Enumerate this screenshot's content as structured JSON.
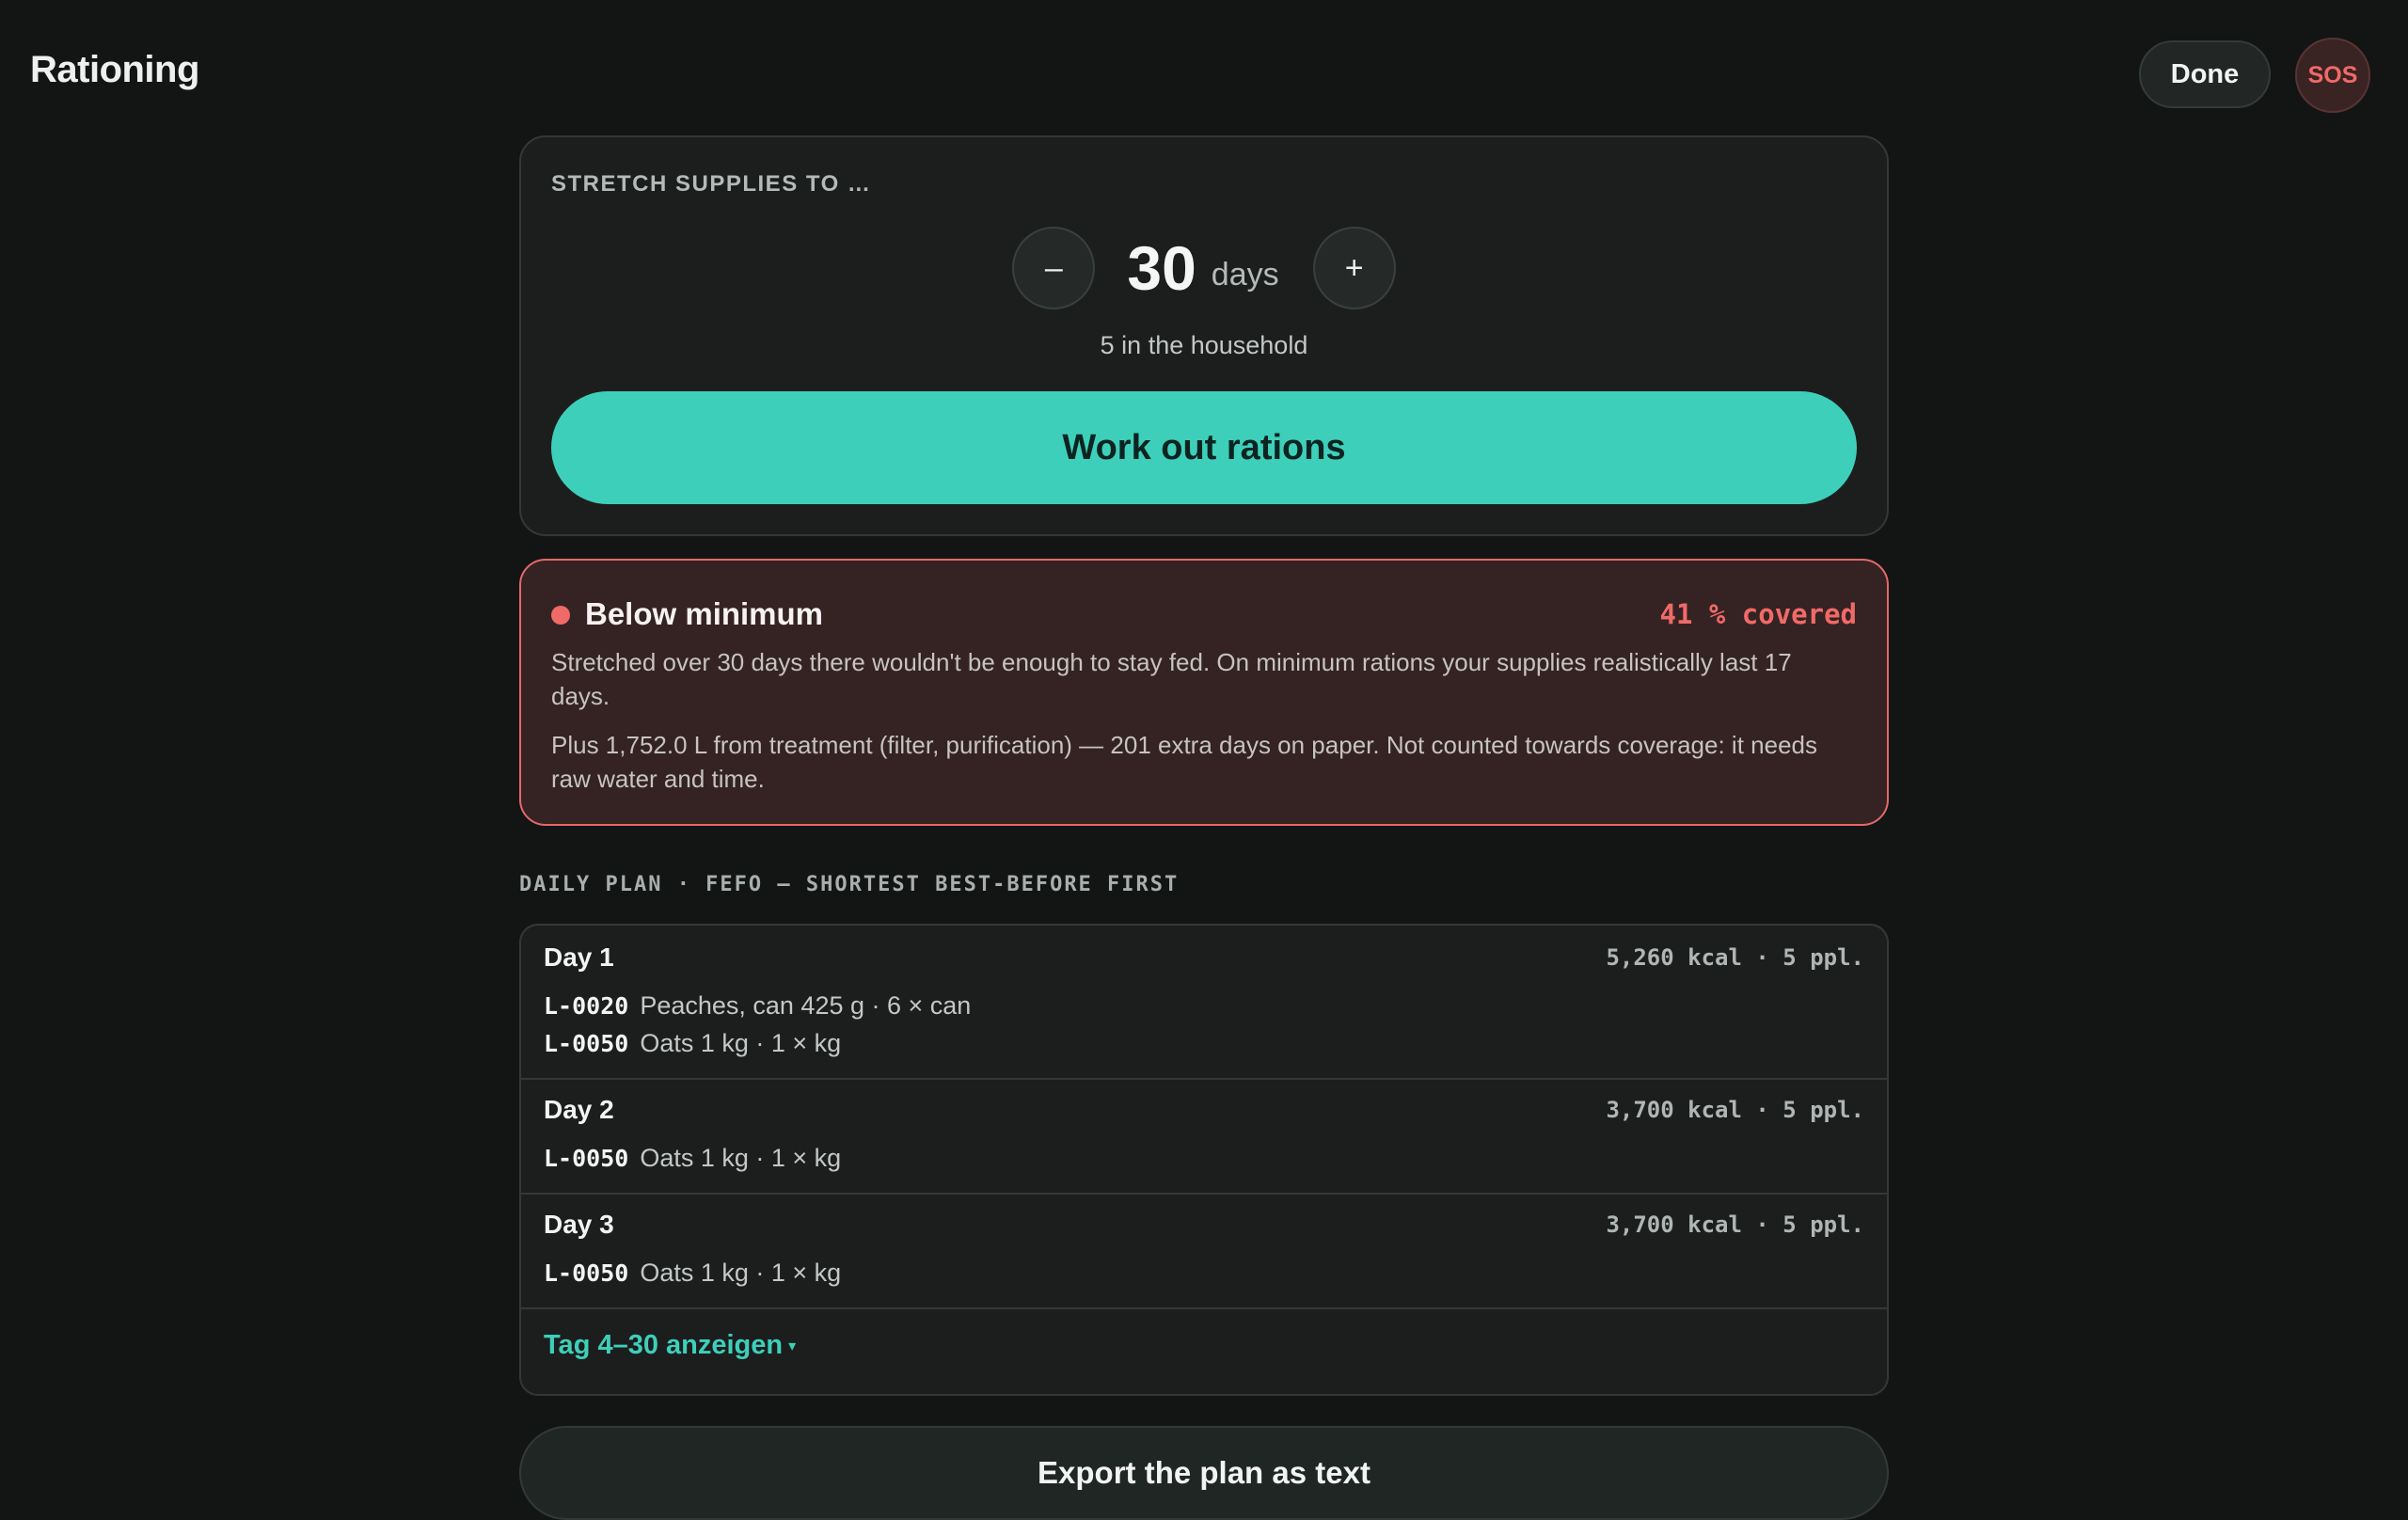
{
  "header": {
    "title": "Rationing",
    "done_label": "Done",
    "sos_label": "SOS"
  },
  "target": {
    "label": "STRETCH SUPPLIES TO …",
    "decrement_label": "–",
    "increment_label": "+",
    "days_value": "30",
    "days_unit": "days",
    "household": "5 in the household",
    "work_out_label": "Work out rations"
  },
  "warning": {
    "title": "Below minimum",
    "coverage": "41 % covered",
    "text1": "Stretched over 30 days there wouldn't be enough to stay fed. On minimum rations your supplies realistically last 17 days.",
    "text2": "Plus 1,752.0 L from treatment (filter, purification) — 201 extra days on paper. Not counted towards coverage: it needs raw water and time.",
    "color": "#f06a68"
  },
  "plan": {
    "heading": "DAILY PLAN · FEFO — SHORTEST BEST-BEFORE FIRST",
    "days": [
      {
        "name": "Day 1",
        "meta": "5,260 kcal · 5 ppl.",
        "items": [
          {
            "lot": "L-0020",
            "desc": "Peaches, can 425 g · 6 × can"
          },
          {
            "lot": "L-0050",
            "desc": "Oats 1 kg · 1 × kg"
          }
        ]
      },
      {
        "name": "Day 2",
        "meta": "3,700 kcal · 5 ppl.",
        "items": [
          {
            "lot": "L-0050",
            "desc": "Oats 1 kg · 1 × kg"
          }
        ]
      },
      {
        "name": "Day 3",
        "meta": "3,700 kcal · 5 ppl.",
        "items": [
          {
            "lot": "L-0050",
            "desc": "Oats 1 kg · 1 × kg"
          }
        ]
      }
    ],
    "more_label": "Tag 4–30 anzeigen",
    "more_caret": "▾"
  },
  "export_label": "Export the plan as text",
  "colors": {
    "accent": "#3ecfbb",
    "danger": "#f06a68",
    "background": "#131515"
  }
}
